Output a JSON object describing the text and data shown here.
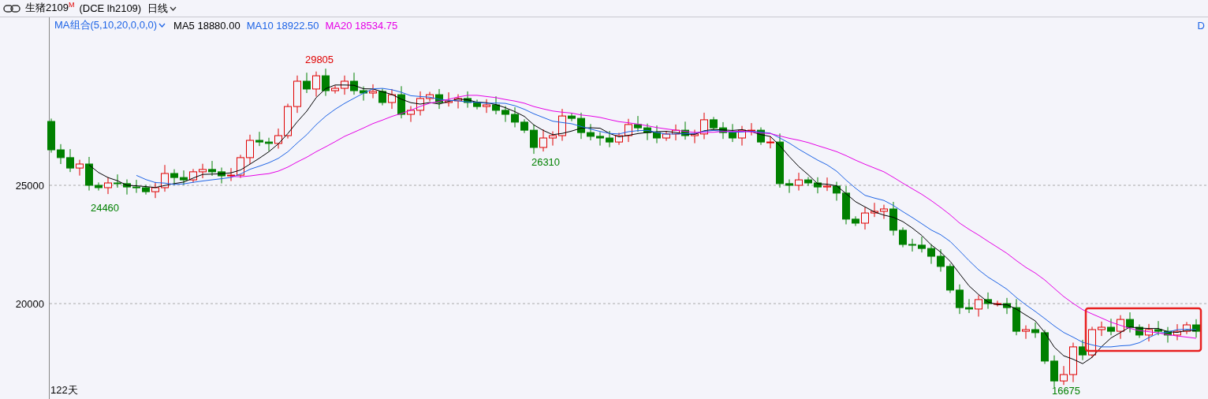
{
  "header": {
    "title": "生猪2109$^{M}$",
    "contract": "(DCE lh2109)",
    "period": "日线"
  },
  "legend": {
    "indicator": "MA组合(5,10,20,0,0,0)",
    "items": [
      {
        "label": "MA5",
        "value": "18880.00",
        "color": "#000000"
      },
      {
        "label": "MA10",
        "value": "18922.50",
        "color": "#1e64e6"
      },
      {
        "label": "MA20",
        "value": "18534.75",
        "color": "#e600e6"
      }
    ],
    "right_label": "D"
  },
  "chart": {
    "day_count": "122天",
    "y_axis_labels": [
      "25000",
      "20000"
    ],
    "price_labels": [
      {
        "text": "29805",
        "color": "#e00000"
      },
      {
        "text": "24460",
        "color": "#008000"
      },
      {
        "text": "26310",
        "color": "#008000"
      },
      {
        "text": "16675",
        "color": "#008000"
      }
    ]
  }
}
